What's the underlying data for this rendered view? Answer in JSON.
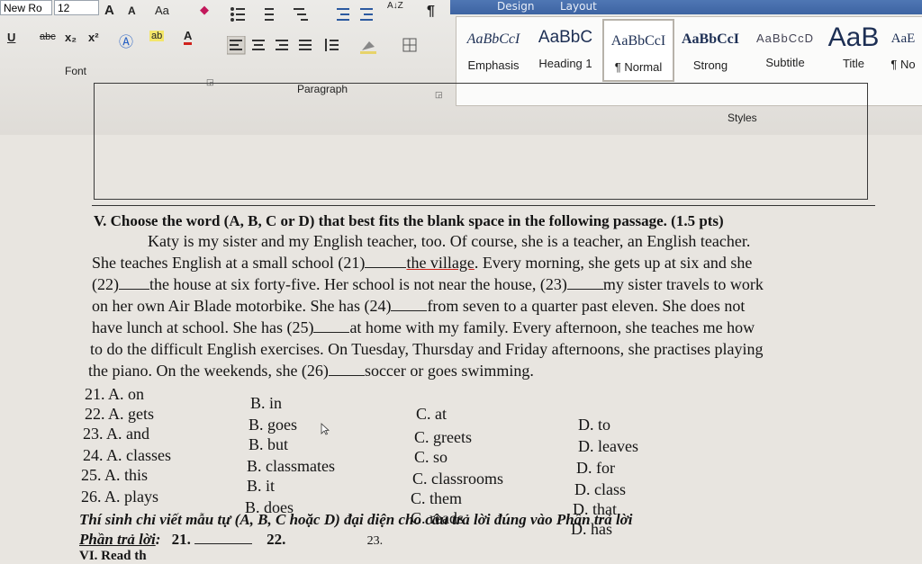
{
  "ribbon": {
    "tabs": [
      "Design",
      "Layout"
    ],
    "font_name": "New Ro",
    "font_size": "12",
    "grow_font": "A",
    "shrink_font": "A",
    "change_case": "Aa",
    "underline": "U",
    "strikethrough": "abc",
    "subscript": "x₂",
    "superscript": "x²",
    "font_group": "Font",
    "paragraph_group": "Paragraph",
    "styles_group": "Styles",
    "sort_icon": "A↓Z",
    "pilcrow": "¶",
    "styles": [
      {
        "preview": "AaBbCcI",
        "name": "Emphasis"
      },
      {
        "preview": "AaBbC",
        "name": "Heading 1"
      },
      {
        "preview": "AaBbCcI",
        "name": "¶ Normal"
      },
      {
        "preview": "AaBbCcI",
        "name": "Strong"
      },
      {
        "preview": "AaBbCcD",
        "name": "Subtitle"
      },
      {
        "preview": "AaB",
        "name": "Title"
      },
      {
        "preview": "AaE",
        "name": "¶ No"
      }
    ]
  },
  "doc": {
    "heading": "V. Choose the word (A, B, C or D) that best fits the blank space in the following passage. (1.5 pts)",
    "p1": "Katy is my sister and my English teacher, too. Of course, she is a teacher, an English teacher.",
    "p2a": "She teaches English at a small school (21)",
    "p2b": "the village",
    "p2c": ". Every morning, she gets up at six and she",
    "p3a": "(22)",
    "p3b": "the house at six forty-five. Her school is not near the house, (23)",
    "p3c": "my sister travels to work",
    "p4a": "on her own Air Blade motorbike. She has (24)",
    "p4b": "from seven to a quarter past eleven. She does not",
    "p5a": "have lunch at school. She has (25)",
    "p5b": "at home with my family. Every afternoon, she teaches me how",
    "p6": "to do the difficult English exercises. On Tuesday, Thursday and Friday afternoons, she practises playing",
    "p7a": "the piano. On the weekends, she (26)",
    "p7b": "soccer or goes swimming.",
    "questions": [
      {
        "a": "21. A. on",
        "b": "B. in",
        "c": "C. at",
        "d": "D. to"
      },
      {
        "a": "22. A. gets",
        "b": "B. goes",
        "c": "C. greets",
        "d": "D. leaves"
      },
      {
        "a": "23. A. and",
        "b": "B. but",
        "c": "C. so",
        "d": "D. for"
      },
      {
        "a": "24. A. classes",
        "b": "B. classmates",
        "c": "C. classrooms",
        "d": "D. class"
      },
      {
        "a": "25. A. this",
        "b": "B. it",
        "c": "C. them",
        "d": "D. that"
      },
      {
        "a": "26. A. plays",
        "b": "B. does",
        "c": "C. reads",
        "d": "D. has"
      }
    ],
    "instruction": "Thí sinh chỉ viết mẫu tự (A, B, C hoặc D) đại diện cho câu trả lời đúng vào Phần trả lời",
    "answer_label": "Phần trả lời",
    "answer_colon": ":",
    "answer_nums": [
      "21.",
      "22.",
      "23."
    ],
    "next_section": "VI. Read th"
  }
}
